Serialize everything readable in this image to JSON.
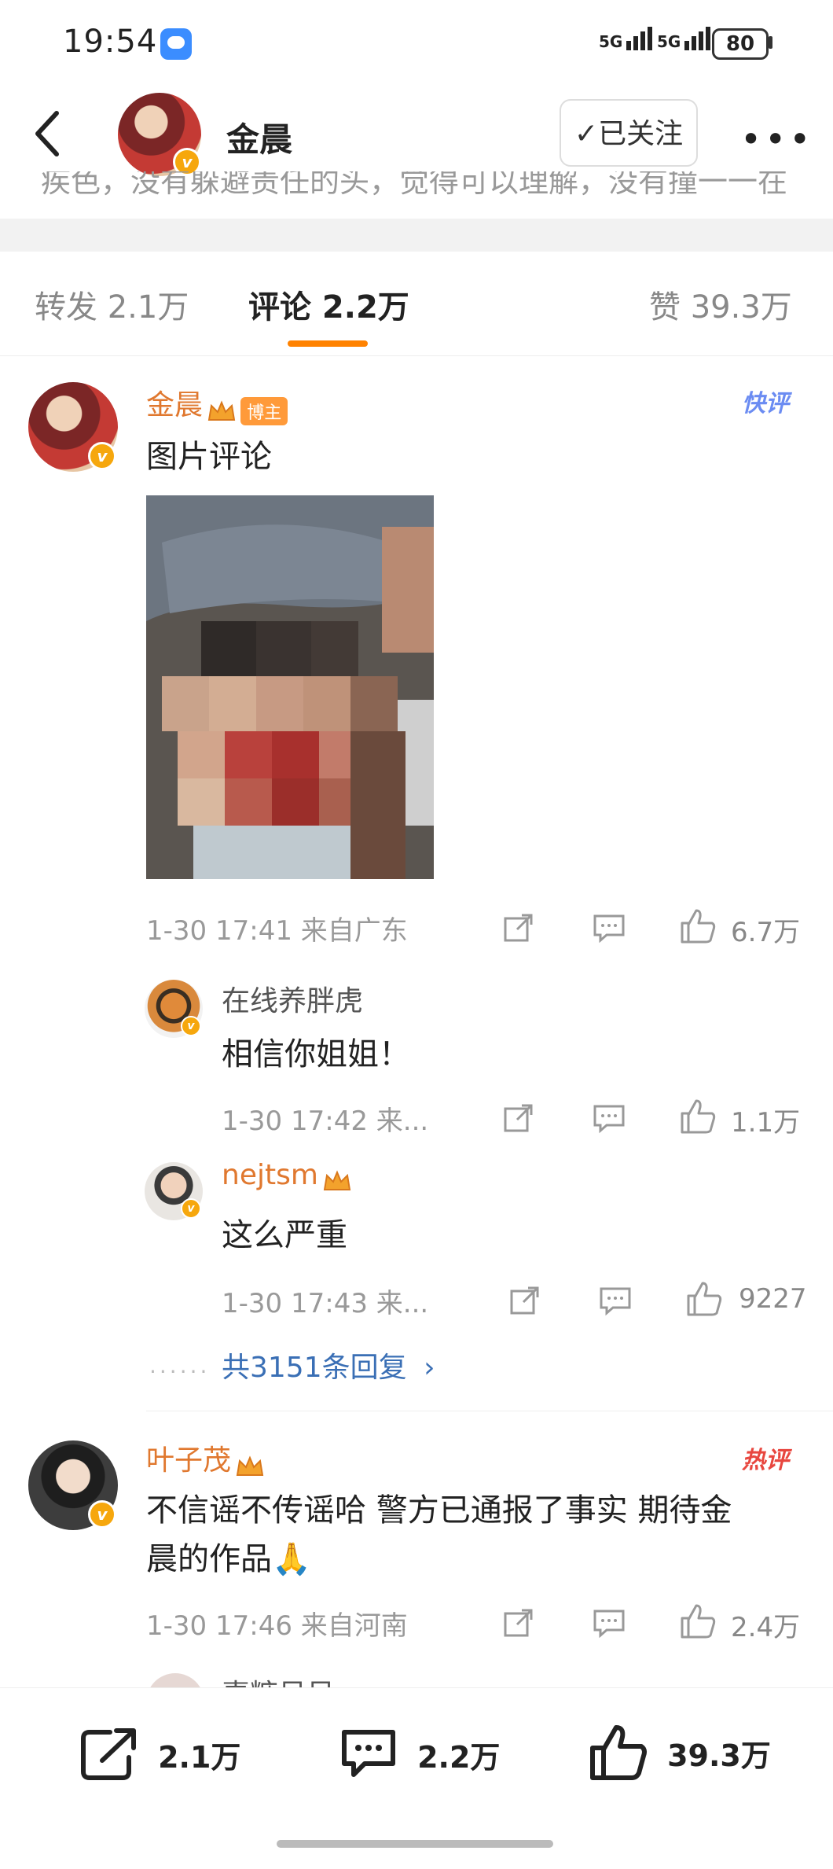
{
  "status_bar": {
    "time": "19:54",
    "network1": "5G",
    "network2": "5G",
    "battery": "80"
  },
  "header": {
    "title": "金晨",
    "follow_label": "✓已关注",
    "more_label": "•••",
    "cutoff_text": "疾色，没有躲避责任的头，觉得可以理解，没有撞一一在"
  },
  "tabs": [
    {
      "label": "转发 2.1万"
    },
    {
      "label": "评论 2.2万"
    },
    {
      "label": "赞 39.3万"
    }
  ],
  "comments": [
    {
      "author": "金晨",
      "tag": "博主",
      "badge": "快评",
      "text": "图片评论",
      "time": "1-30 17:41  来自广东",
      "likes": "6.7万",
      "replies": [
        {
          "author": "在线养胖虎",
          "text": "相信你姐姐！",
          "time": "1-30 17:42  来...",
          "likes": "1.1万"
        },
        {
          "author": "nejtsm",
          "text": "这么严重",
          "time": "1-30 17:43  来...",
          "likes": "9227"
        }
      ],
      "more_replies": "共3151条回复"
    },
    {
      "author": "叶子茂",
      "badge": "热评",
      "text_line1": "不信谣不传谣哈 警方已通报了事实 期待金",
      "text_line2": "晨的作品🙏",
      "time": "1-30 17:46  来自河南",
      "likes": "2.4万"
    },
    {
      "author": "喜糖呆呆"
    }
  ],
  "bottom_bar": {
    "repost": "2.1万",
    "comment": "2.2万",
    "like": "39.3万"
  },
  "colors": {
    "accent_orange": "#ff8200",
    "name_orange": "#e0782f",
    "quick_badge": "#6b8cf2",
    "hot_badge": "#e8473f"
  }
}
